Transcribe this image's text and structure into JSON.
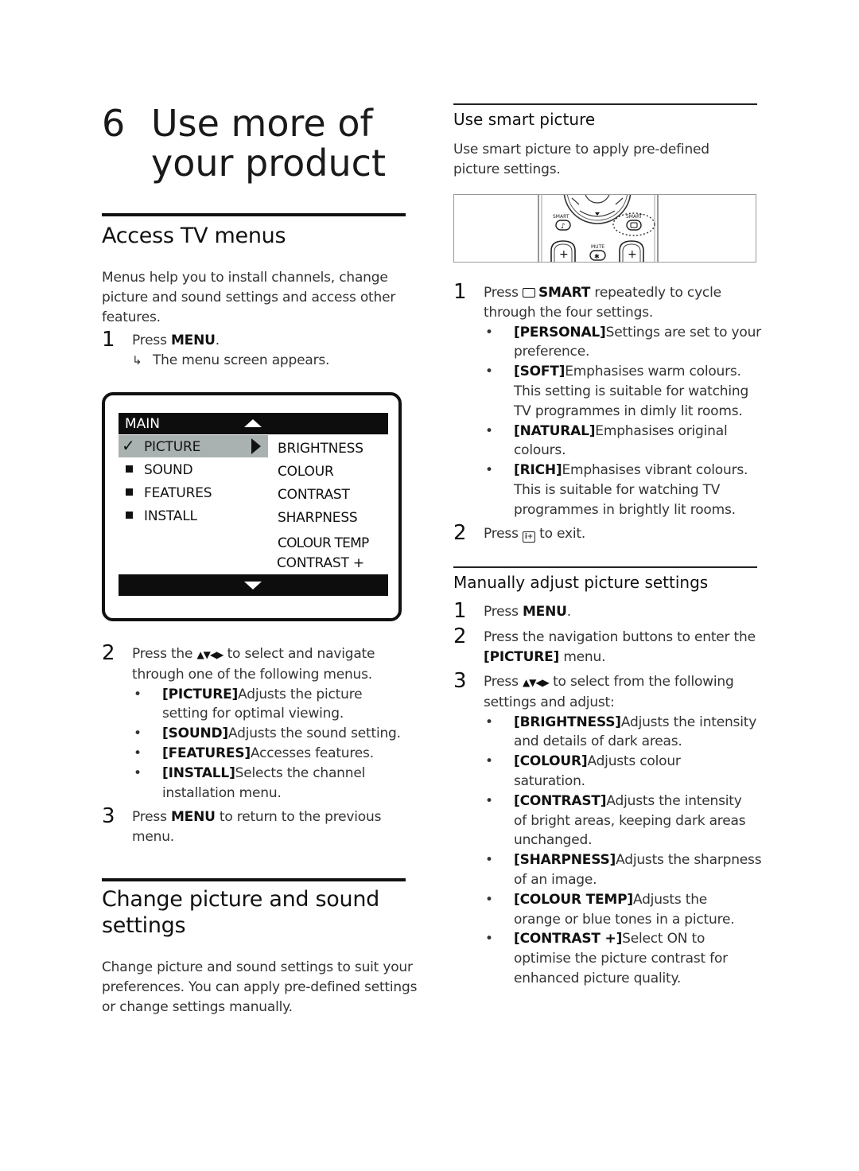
{
  "chapter": {
    "number": "6",
    "title_line1": "Use more of",
    "title_line2": "your product"
  },
  "access_tv_menus": {
    "heading": "Access TV menus",
    "intro": [
      "Menus help you to install channels, change",
      "picture and sound settings and access other",
      "features."
    ],
    "step1": {
      "num": "1",
      "prefix": "Press ",
      "key": "MENU",
      "suffix": ".",
      "result_icon": "result-arrow-icon",
      "result": "The menu screen appears."
    },
    "tv_menu": {
      "header": "MAIN",
      "left_items": [
        {
          "label": "PICTURE",
          "selected": true,
          "icon": "checkmark-icon"
        },
        {
          "label": "SOUND",
          "selected": false,
          "icon": "square-bullet-icon"
        },
        {
          "label": "FEATURES",
          "selected": false,
          "icon": "square-bullet-icon"
        },
        {
          "label": "INSTALL",
          "selected": false,
          "icon": "square-bullet-icon"
        }
      ],
      "right_items": [
        "BRIGHTNESS",
        "COLOUR",
        "CONTRAST",
        "SHARPNESS",
        "COLOUR TEMP",
        "CONTRAST +"
      ],
      "highlight_color": "#a9b2b1",
      "bar_color": "#0d0d0d"
    },
    "step2": {
      "num": "2",
      "line1_prefix": "Press the ",
      "arrows": "▲▼◀▶",
      "line1_suffix": " to select and navigate",
      "line2": "through one of the following menus.",
      "bullets": [
        {
          "key": "[PICTURE]",
          "lines": [
            "Adjusts the picture",
            "setting for optimal viewing."
          ]
        },
        {
          "key": "[SOUND]",
          "lines": [
            "Adjusts the sound setting."
          ]
        },
        {
          "key": "[FEATURES]",
          "lines": [
            "Accesses features."
          ]
        },
        {
          "key": "[INSTALL]",
          "lines": [
            "Selects the channel",
            "installation menu."
          ]
        }
      ]
    },
    "step3": {
      "num": "3",
      "prefix": "Press ",
      "key": "MENU",
      "suffix": " to return to the previous",
      "line2": "menu."
    }
  },
  "change_settings": {
    "heading_line1": "Change picture and sound",
    "heading_line2": "settings",
    "intro": [
      "Change picture and sound settings to suit your",
      "preferences. You can apply pre-defined settings",
      "or change settings manually."
    ]
  },
  "smart_picture": {
    "heading": "Use smart picture",
    "intro": [
      "Use smart picture to apply pre-defined",
      "picture settings."
    ],
    "remote_labels": {
      "smart_left": "SMART",
      "smart_right": "SMART",
      "mute": "MUTE"
    },
    "step1": {
      "num": "1",
      "prefix": "Press ",
      "icon": "smart-picture-icon",
      "key": "SMART",
      "suffix": " repeatedly to cycle",
      "line2": "through the four settings.",
      "bullets": [
        {
          "key": "[PERSONAL]",
          "lines": [
            "Settings are set to your",
            "preference."
          ]
        },
        {
          "key": "[SOFT]",
          "lines": [
            "Emphasises warm colours.",
            "This setting is suitable for watching",
            "TV programmes in dimly lit rooms."
          ]
        },
        {
          "key": "[NATURAL]",
          "lines": [
            "Emphasises original",
            "colours."
          ]
        },
        {
          "key": "[RICH]",
          "lines": [
            "Emphasises vibrant colours.",
            "This is suitable for watching TV",
            "programmes in brightly lit rooms."
          ]
        }
      ]
    },
    "step2": {
      "num": "2",
      "prefix": "Press ",
      "icon": "info-exit-icon",
      "suffix": " to exit."
    }
  },
  "manual_adjust": {
    "heading": "Manually adjust picture settings",
    "step1": {
      "num": "1",
      "prefix": "Press ",
      "key": "MENU",
      "suffix": "."
    },
    "step2": {
      "num": "2",
      "line1": "Press the navigation buttons to enter the",
      "key": "[PICTURE]",
      "suffix": " menu."
    },
    "step3": {
      "num": "3",
      "prefix": "Press ",
      "arrows": "▲▼◀▶",
      "suffix": " to select from the following",
      "line2": "settings and adjust:",
      "bullets": [
        {
          "key": "[BRIGHTNESS]",
          "lines": [
            "Adjusts the intensity",
            "and details of dark areas."
          ]
        },
        {
          "key": "[COLOUR]",
          "lines": [
            "Adjusts colour",
            "saturation."
          ]
        },
        {
          "key": "[CONTRAST]",
          "lines": [
            "Adjusts the intensity",
            "of bright areas, keeping dark areas",
            "unchanged."
          ]
        },
        {
          "key": "[SHARPNESS]",
          "lines": [
            "Adjusts the sharpness",
            "of an image."
          ]
        },
        {
          "key": "[COLOUR TEMP]",
          "lines": [
            "Adjusts the",
            "orange or blue tones in a picture."
          ]
        },
        {
          "key": "[CONTRAST +]",
          "lines": [
            "Select ON to",
            "optimise the picture contrast for",
            "enhanced picture quality."
          ]
        }
      ]
    }
  }
}
